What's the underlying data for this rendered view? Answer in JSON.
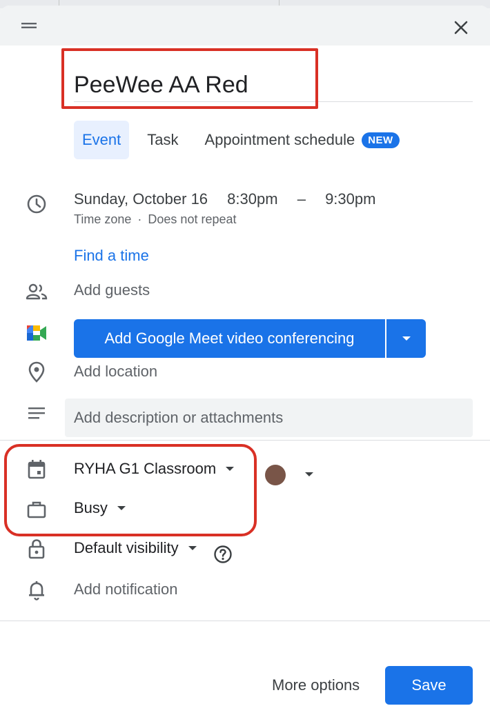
{
  "event": {
    "title": "PeeWee AA Red"
  },
  "tabs": [
    {
      "label": "Event",
      "active": true
    },
    {
      "label": "Task",
      "active": false
    },
    {
      "label": "Appointment schedule",
      "active": false,
      "badge": "NEW"
    }
  ],
  "datetime": {
    "date": "Sunday, October 16",
    "start": "8:30pm",
    "separator": "–",
    "end": "9:30pm",
    "timezone": "Time zone",
    "dot": "·",
    "repeat": "Does not repeat"
  },
  "find_time": "Find a time",
  "guests_placeholder": "Add guests",
  "meet_button": "Add Google Meet video conferencing",
  "location_placeholder": "Add location",
  "description_placeholder": "Add description or attachments",
  "calendar": {
    "name": "RYHA G1 Classroom",
    "color": "#795548"
  },
  "availability": "Busy",
  "visibility": "Default visibility",
  "notification": "Add notification",
  "footer": {
    "more_options": "More options",
    "save": "Save"
  },
  "colors": {
    "accent": "#1a73e8",
    "highlight_red": "#d93025",
    "calendar_dot": "#795548"
  },
  "icons": [
    "drag-handle-icon",
    "close-icon",
    "clock-icon",
    "guests-icon",
    "google-meet-icon",
    "location-pin-icon",
    "description-lines-icon",
    "calendar-icon",
    "briefcase-icon",
    "lock-icon",
    "bell-icon",
    "help-icon",
    "chevron-down-icon"
  ]
}
